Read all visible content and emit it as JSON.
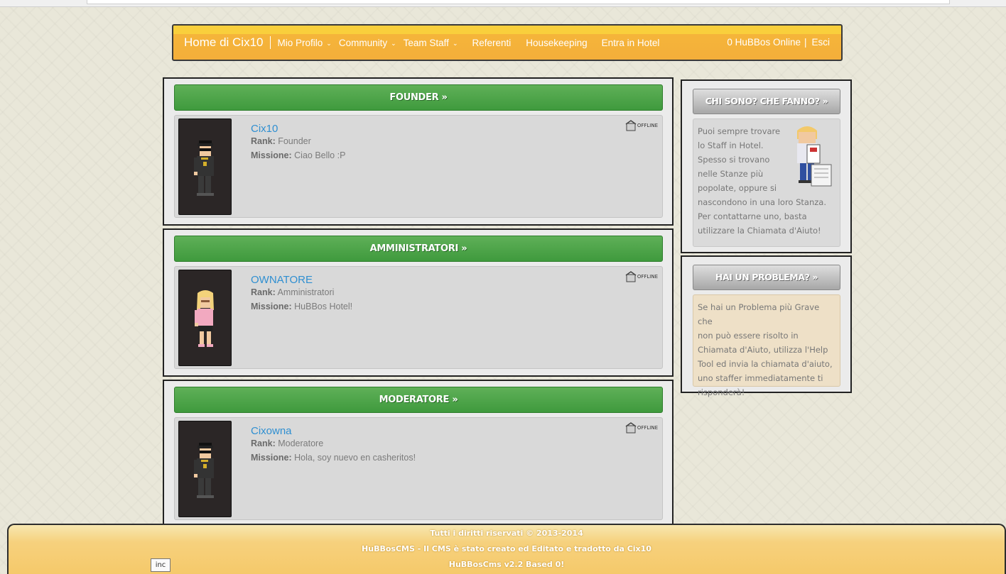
{
  "nav": {
    "brand": "Home di Cix10",
    "items": [
      {
        "label": "Mio Profilo",
        "dropdown": true
      },
      {
        "label": "Community",
        "dropdown": true
      },
      {
        "label": "Team Staff",
        "dropdown": true
      },
      {
        "label": "Referenti",
        "dropdown": false
      },
      {
        "label": "Housekeeping",
        "dropdown": false
      },
      {
        "label": "Entra in Hotel",
        "dropdown": false
      }
    ],
    "online": "0 HuBBos Online",
    "separator": "|",
    "logout": "Esci"
  },
  "sections": [
    {
      "title": "FOUNDER »",
      "member": {
        "name": "Cix10",
        "rank_label": "Rank:",
        "rank": "Founder",
        "mission_label": "Missione:",
        "mission": "Ciao Bello :P",
        "status": "OFFLINE",
        "avatar": "male-black-outfit"
      }
    },
    {
      "title": "AMMINISTRATORI »",
      "member": {
        "name": "OWNATORE",
        "rank_label": "Rank:",
        "rank": "Amministratori",
        "mission_label": "Missione:",
        "mission": "HuBBos Hotel!",
        "status": "OFFLINE",
        "avatar": "female-pink-outfit"
      }
    },
    {
      "title": "MODERATORE »",
      "member": {
        "name": "Cixowna",
        "rank_label": "Rank:",
        "rank": "Moderatore",
        "mission_label": "Missione:",
        "mission": "Hola, soy nuevo en casheritos!",
        "status": "OFFLINE",
        "avatar": "male-black-outfit"
      }
    }
  ],
  "sidebar": {
    "who": {
      "title": "CHI SONO? CHE FANNO? »",
      "lines": [
        "Puoi sempre trovare",
        "lo Staff in Hotel.",
        "Spesso si trovano",
        "nelle Stanze più",
        "popolate, oppure si",
        "nascondono in una loro Stanza.",
        "Per contattarne uno, basta",
        "utilizzare la Chiamata d'Aiuto!"
      ]
    },
    "problem": {
      "title": "HAI UN PROBLEMA? »",
      "lines": [
        "Se hai un Problema più Grave che",
        "non può essere risolto in",
        "Chiamata d'Aiuto, utilizza l'Help",
        "Tool ed invia la chiamata d'aiuto,",
        "uno staffer immediatamente ti",
        "risponderà!"
      ]
    }
  },
  "footer": {
    "line1": "Tutti i diritti riservati © 2013-2014",
    "line2": "HuBBosCMS - Il CMS è stato creato ed Editato e tradotto da Cix10",
    "line3": "HuBBosCms v2.2 Based 0!"
  },
  "inc_label": "inc",
  "colors": {
    "nav_bg": "#f4ae3a",
    "section_green": "#4ca447",
    "link_blue": "#2f8fd1",
    "sidebar_grey": "#a7a7a7",
    "footer_bg": "#f5c96a"
  }
}
